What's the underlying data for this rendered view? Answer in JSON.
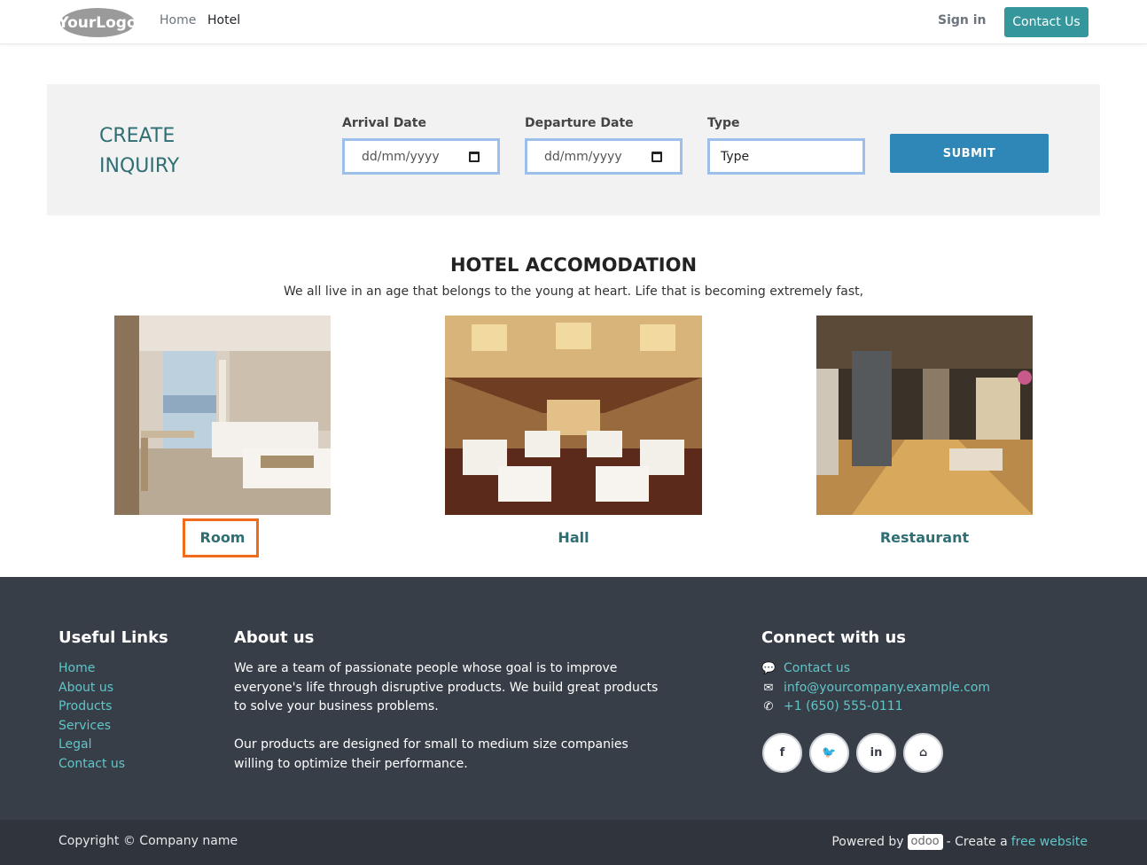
{
  "nav": {
    "logo_text": "YourLogo",
    "links": [
      "Home",
      "Hotel"
    ],
    "signin": "Sign in",
    "contact": "Contact Us"
  },
  "inquiry": {
    "title_line1": "CREATE",
    "title_line2": "INQUIRY",
    "arrival_label": "Arrival Date",
    "arrival_placeholder": "dd/mm/yyyy",
    "departure_label": "Departure Date",
    "departure_placeholder": "dd/mm/yyyy",
    "type_label": "Type",
    "type_value": "Type",
    "submit": "SUBMIT"
  },
  "accommodation": {
    "title": "HOTEL ACCOMODATION",
    "subtitle": "We all live in an age that belongs to the young at heart. Life that is becoming extremely fast,",
    "items": [
      "Room",
      "Hall",
      "Restaurant"
    ]
  },
  "footer": {
    "useful_links_title": "Useful Links",
    "useful_links": [
      "Home",
      "About us",
      "Products",
      "Services",
      "Legal",
      "Contact us"
    ],
    "about_title": "About us",
    "about_p1": "We are a team of passionate people whose goal is to improve everyone's life through disruptive products. We build great products to solve your business problems.",
    "about_p2": "Our products are designed for small to medium size companies willing to optimize their performance.",
    "connect_title": "Connect with us",
    "connect_contact": "Contact us",
    "connect_email": "info@yourcompany.example.com",
    "connect_phone": "+1 (650) 555-0111",
    "social_icons": [
      "facebook-icon",
      "twitter-icon",
      "linkedin-icon",
      "home-icon"
    ],
    "copyright": "Copyright © Company name",
    "powered_by": "Powered by",
    "odoo": "odoo",
    "create_a": "- Create a",
    "free_website": "free website"
  },
  "colors": {
    "accent": "#35979c",
    "submit": "#2e87b6",
    "title_teal": "#2f6f74",
    "footer_bg": "#383e48",
    "link_teal": "#5fc6c9",
    "highlight": "#f26a1b"
  }
}
